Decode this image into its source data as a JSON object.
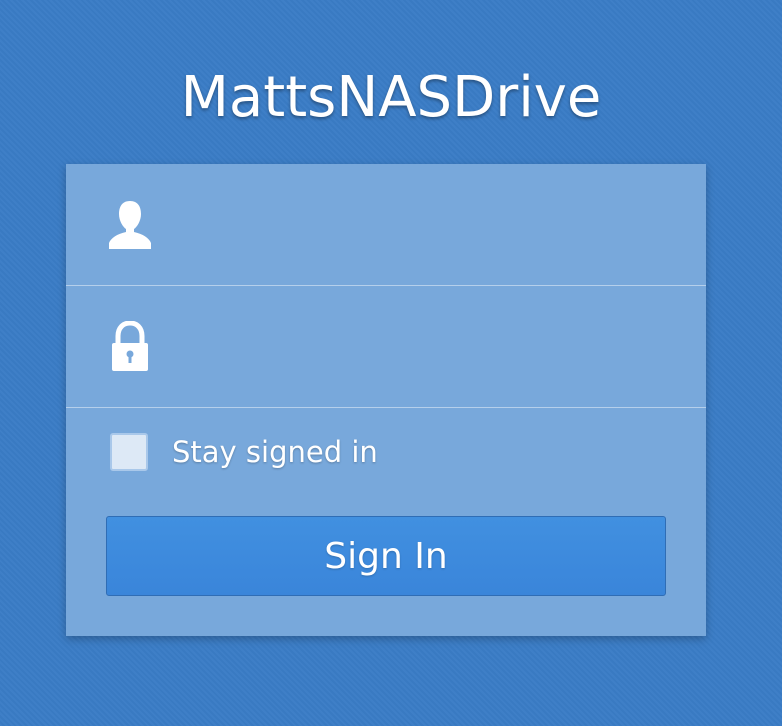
{
  "app": {
    "title": "MattsNASDrive"
  },
  "login": {
    "username": {
      "value": "",
      "placeholder": "",
      "icon": "user-icon"
    },
    "password": {
      "value": "",
      "placeholder": "",
      "icon": "lock-icon"
    },
    "stay_signed_in": {
      "label": "Stay signed in",
      "checked": false
    },
    "sign_in_label": "Sign In"
  },
  "colors": {
    "background": "#3a7cc6",
    "panel": "#78a8db",
    "button": "#3d8ade",
    "text": "#ffffff"
  }
}
